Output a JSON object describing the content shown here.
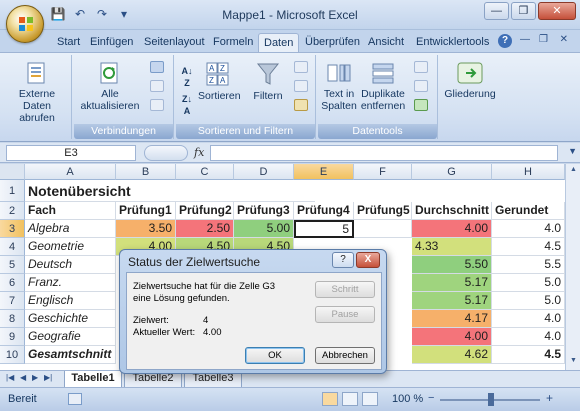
{
  "window": {
    "title": "Mappe1 - Microsoft Excel"
  },
  "ribbon_tabs": [
    "Start",
    "Einfügen",
    "Seitenlayout",
    "Formeln",
    "Daten",
    "Überprüfen",
    "Ansicht",
    "Entwicklertools"
  ],
  "ribbon": {
    "externe_daten": "Externe Daten abrufen",
    "alle_aktualisieren": "Alle aktualisieren",
    "sortieren": "Sortieren",
    "filtern": "Filtern",
    "text_in_spalten": "Text in Spalten",
    "duplikate_entfernen": "Duplikate entfernen",
    "gliederung": "Gliederung",
    "group_verbindungen": "Verbindungen",
    "group_sortieren_filtern": "Sortieren und Filtern",
    "group_datentools": "Datentools"
  },
  "formula_bar": {
    "name_box": "E3",
    "fx": "fx",
    "formula": ""
  },
  "columns": [
    "A",
    "B",
    "C",
    "D",
    "E",
    "F",
    "G",
    "H"
  ],
  "rows": [
    "1",
    "2",
    "3",
    "4",
    "5",
    "6",
    "7",
    "8",
    "9",
    "10"
  ],
  "sheet": {
    "title": "Notenübersicht",
    "headers": [
      "Fach",
      "Prüfung1",
      "Prüfung2",
      "Prüfung3",
      "Prüfung4",
      "Prüfung5",
      "Durchschnitt",
      "Gerundet"
    ],
    "subjects": [
      {
        "name": "Algebra",
        "p1": "3.50",
        "p2": "2.50",
        "p3": "5.00",
        "p4": "5",
        "avg": "4.00",
        "round": "4.0"
      },
      {
        "name": "Geometrie",
        "p1": "4.00",
        "p2": "4.50",
        "p3": "4.50",
        "p4": "",
        "avg": "4.33",
        "round": "4.5"
      },
      {
        "name": "Deutsch",
        "p1": "",
        "p2": "",
        "p3": "",
        "p4": "",
        "avg": "5.50",
        "round": "5.5"
      },
      {
        "name": "Franz.",
        "p1": "",
        "p2": "",
        "p3": "",
        "p4": "",
        "avg": "5.17",
        "round": "5.0"
      },
      {
        "name": "Englisch",
        "p1": "",
        "p2": "",
        "p3": "",
        "p4": "",
        "avg": "5.17",
        "round": "5.0"
      },
      {
        "name": "Geschichte",
        "p1": "",
        "p2": "",
        "p3": "",
        "p4": "",
        "avg": "4.17",
        "round": "4.0"
      },
      {
        "name": "Geografie",
        "p1": "",
        "p2": "",
        "p3": "",
        "p4": "",
        "avg": "4.00",
        "round": "4.0"
      }
    ],
    "total": {
      "name": "Gesamtschnitt",
      "avg": "4.62",
      "round": "4.5"
    },
    "colors": {
      "red": "#f4747a",
      "orange": "#f6b06a",
      "yellow_green": "#d2e07c",
      "green": "#8fcf7e"
    }
  },
  "dialog": {
    "title": "Status der Zielwertsuche",
    "message_line1": "Zielwertsuche hat für die Zelle G3",
    "message_line2": "eine Lösung gefunden.",
    "target_label": "Zielwert:",
    "target_value": "4",
    "current_label": "Aktueller Wert:",
    "current_value": "4.00",
    "step_button": "Schritt",
    "pause_button": "Pause",
    "ok_button": "OK",
    "cancel_button": "Abbrechen",
    "help_symbol": "?",
    "close_symbol": "X"
  },
  "sheet_tabs": [
    "Tabelle1",
    "Tabelle2",
    "Tabelle3"
  ],
  "status": {
    "mode": "Bereit",
    "zoom": "100 %"
  }
}
